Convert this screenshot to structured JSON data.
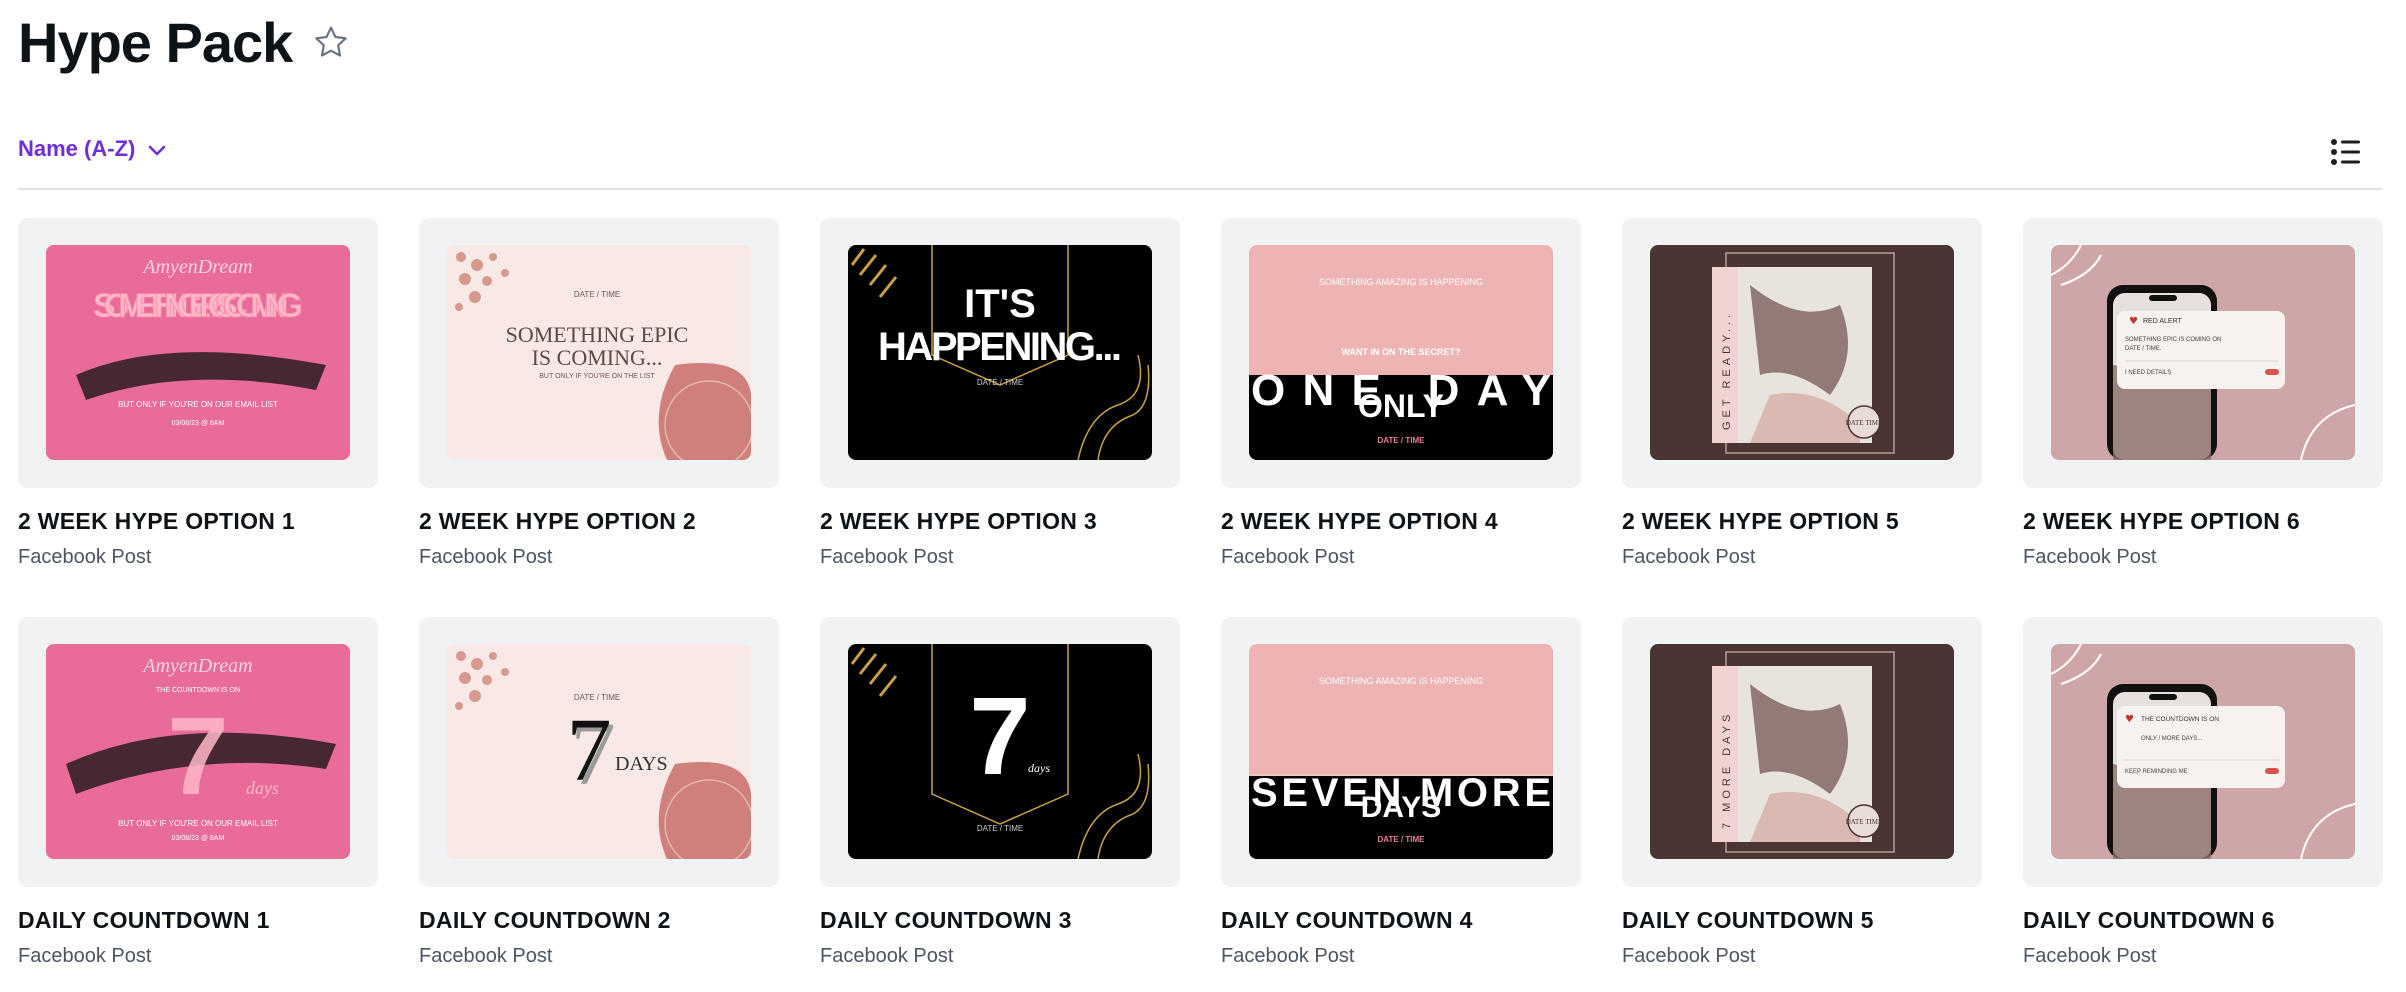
{
  "header": {
    "title": "Hype Pack",
    "star_icon": "star-outline-icon"
  },
  "toolbar": {
    "sort_label": "Name (A-Z)",
    "sort_icon": "chevron-down-icon",
    "view_icon": "list-view-icon"
  },
  "colors": {
    "accent": "#6f2fd8",
    "card_bg": "#f1f2f4",
    "pink": "#e45a8c",
    "blush": "#f8e9e6",
    "black": "#000000",
    "brown": "#4a3533",
    "mauve": "#cfa6a8"
  },
  "designs": [
    {
      "title": "2 WEEK HYPE OPTION 1",
      "type": "Facebook Post",
      "thumb": {
        "big": "SOMETHING EPIC IS COMING",
        "small": "BUT ONLY IF YOU'RE ON OUR EMAIL LIST",
        "date": "03/08/23 @ 8AM",
        "script": "AmyenDream"
      }
    },
    {
      "title": "2 WEEK HYPE OPTION 2",
      "type": "Facebook Post",
      "thumb": {
        "date": "DATE / TIME",
        "big": "SOMETHING EPIC",
        "big2": "IS COMING...",
        "small": "BUT ONLY IF YOU'RE ON THE LIST"
      }
    },
    {
      "title": "2 WEEK HYPE OPTION 3",
      "type": "Facebook Post",
      "thumb": {
        "big": "IT'S",
        "big2": "HAPPENING...",
        "date": "DATE / TIME"
      }
    },
    {
      "title": "2 WEEK HYPE OPTION 4",
      "type": "Facebook Post",
      "thumb": {
        "arc": "SOMETHING AMAZING IS HAPPENING",
        "small": "WANT IN ON THE SECRET?",
        "big": "ONE DAY",
        "big2": "ONLY",
        "date": "DATE / TIME"
      }
    },
    {
      "title": "2 WEEK HYPE OPTION 5",
      "type": "Facebook Post",
      "thumb": {
        "side": "GET READY...",
        "badge": "DATE TIME"
      }
    },
    {
      "title": "2 WEEK HYPE OPTION 6",
      "type": "Facebook Post",
      "thumb": {
        "alert": "RED ALERT",
        "line1": "SOMETHING EPIC IS COMING ON",
        "line2": "DATE / TIME.",
        "toggle": "I NEED DETAILS"
      }
    },
    {
      "title": "DAILY COUNTDOWN 1",
      "type": "Facebook Post",
      "thumb": {
        "script": "AmyenDream",
        "top": "THE COUNTDOWN IS ON",
        "big": "7",
        "sub": "days",
        "small": "BUT ONLY IF YOU'RE ON OUR EMAIL LIST",
        "date": "03/08/23 @ 8AM"
      }
    },
    {
      "title": "DAILY COUNTDOWN 2",
      "type": "Facebook Post",
      "thumb": {
        "date": "DATE / TIME",
        "big": "7",
        "sub": "DAYS"
      }
    },
    {
      "title": "DAILY COUNTDOWN 3",
      "type": "Facebook Post",
      "thumb": {
        "big": "7",
        "sub": "days",
        "date": "DATE / TIME"
      }
    },
    {
      "title": "DAILY COUNTDOWN 4",
      "type": "Facebook Post",
      "thumb": {
        "arc": "SOMETHING AMAZING IS HAPPENING",
        "big": "SEVEN MORE",
        "big2": "DAYS",
        "date": "DATE / TIME"
      }
    },
    {
      "title": "DAILY COUNTDOWN 5",
      "type": "Facebook Post",
      "thumb": {
        "side": "7 MORE DAYS",
        "badge": "DATE TIME"
      }
    },
    {
      "title": "DAILY COUNTDOWN 6",
      "type": "Facebook Post",
      "thumb": {
        "line1": "THE COUNTDOWN IS ON",
        "line2": "ONLY / MORE DAYS...",
        "toggle": "KEEP REMINDING ME"
      }
    }
  ]
}
